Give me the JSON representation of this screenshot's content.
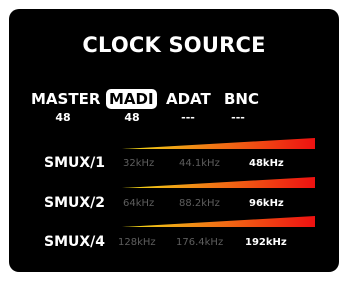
{
  "title": "CLOCK SOURCE",
  "sources": [
    {
      "label": "MASTER",
      "rate": "48"
    },
    {
      "label": "MADI",
      "rate": "48"
    },
    {
      "label": "ADAT",
      "rate": "---"
    },
    {
      "label": "BNC",
      "rate": "---"
    }
  ],
  "smux_rows": [
    {
      "label": "SMUX/1",
      "freqs": [
        "32kHz",
        "44.1kHz",
        "48kHz"
      ]
    },
    {
      "label": "SMUX/2",
      "freqs": [
        "64kHz",
        "88.2kHz",
        "96kHz"
      ]
    },
    {
      "label": "SMUX/4",
      "freqs": [
        "128kHz",
        "176.4kHz",
        "192kHz"
      ]
    }
  ],
  "colors": {
    "background": "#000000",
    "text": "#ffffff",
    "inactive_text": "#5e5e5e",
    "bar_start": "#f2e21a",
    "bar_end": "#ee1111"
  }
}
